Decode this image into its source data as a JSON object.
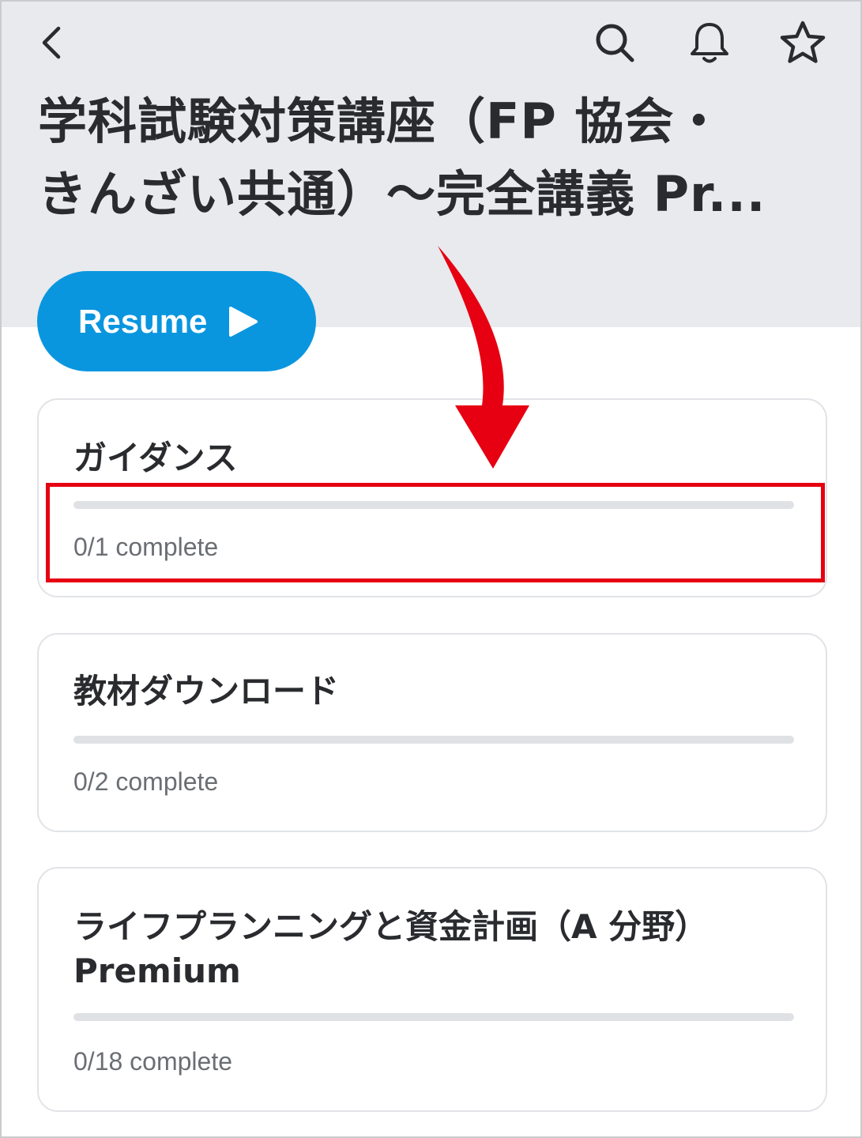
{
  "nav": {
    "back_icon": "chevron-left-icon",
    "search_icon": "search-icon",
    "bell_icon": "bell-icon",
    "star_icon": "star-icon"
  },
  "course": {
    "title_line1": "学科試験対策講座（FP 協会・",
    "title_line2": "きんざい共通）〜完全講義 Pr..."
  },
  "resume": {
    "label": "Resume",
    "icon": "play-icon"
  },
  "sections": [
    {
      "title": "ガイダンス",
      "progress": "0/1 complete",
      "progress_fraction": 0
    },
    {
      "title": "教材ダウンロード",
      "progress": "0/2 complete",
      "progress_fraction": 0
    },
    {
      "title_line1": "ライフプランニングと資金計画（A 分野）",
      "title_line2": "Premium",
      "progress": "0/18 complete",
      "progress_fraction": 0
    }
  ],
  "colors": {
    "header_bg": "#e8eaed",
    "accent": "#0a96df",
    "annotation": "#e60012"
  }
}
